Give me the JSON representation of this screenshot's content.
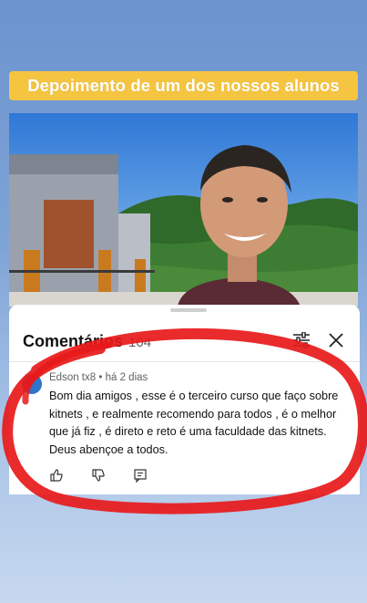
{
  "banner": {
    "text": "Depoimento de um dos nossos alunos"
  },
  "comments_panel": {
    "title": "Comentários",
    "count": "104",
    "comment": {
      "author": "Edson tx8",
      "time": "há 2 dias",
      "text": "Bom dia amigos , esse é o terceiro curso que faço sobre kitnets , e realmente recomendo para todos , é o melhor  que já fiz , é direto e reto é uma faculdade das kitnets. Deus abençoe a todos."
    }
  },
  "colors": {
    "banner": "#f5c542",
    "highlight_circle": "#e8191a",
    "sky": "#2f78d6"
  },
  "icons": [
    "filter-icon",
    "close-icon",
    "like-icon",
    "dislike-icon",
    "reply-icon"
  ]
}
